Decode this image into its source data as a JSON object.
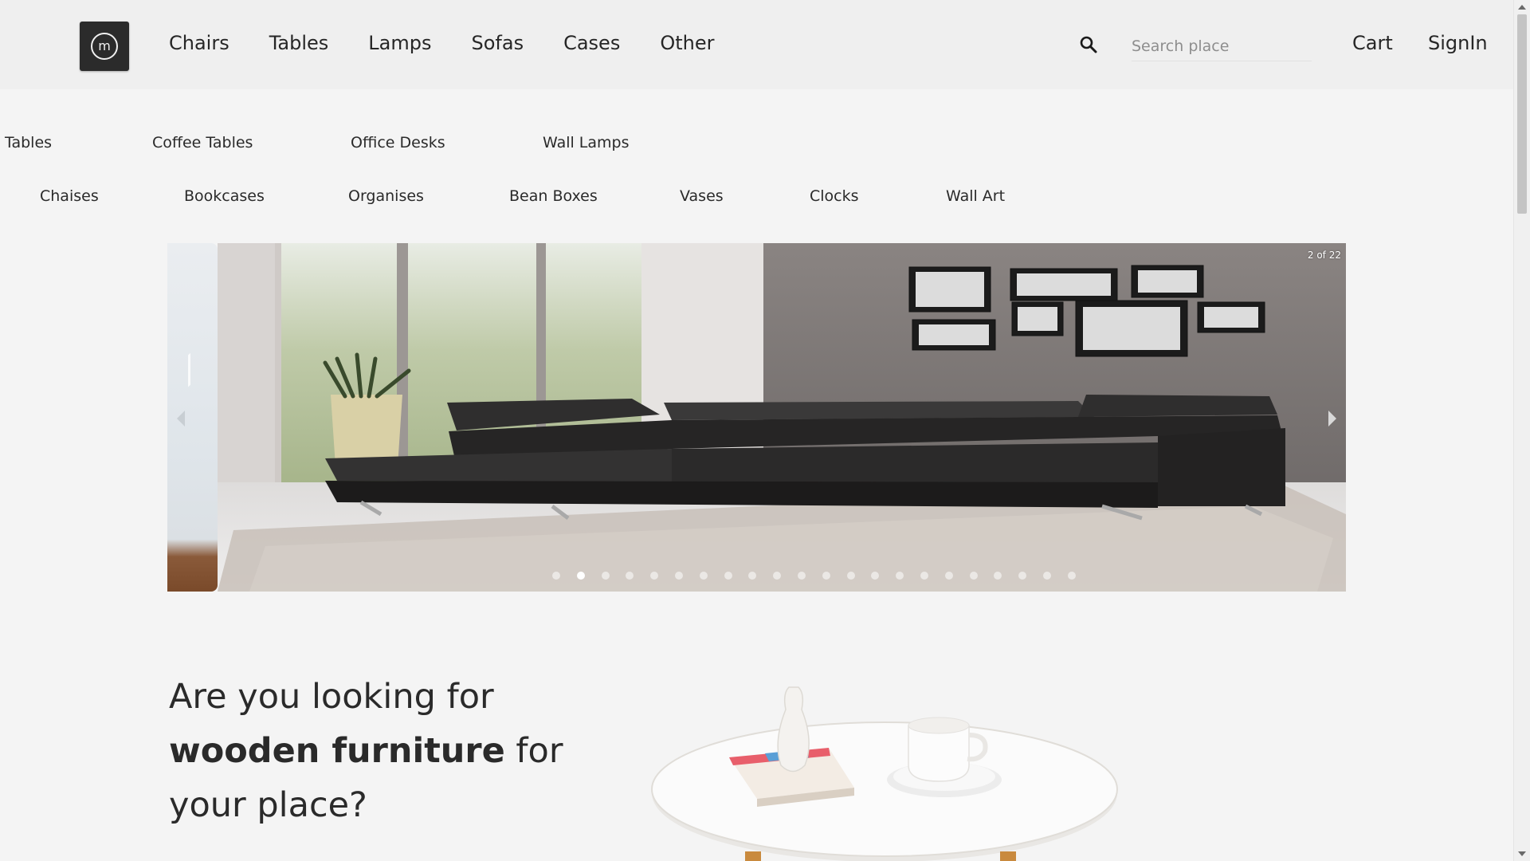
{
  "header": {
    "logo_letter": "m",
    "nav": [
      {
        "label": "Chairs"
      },
      {
        "label": "Tables"
      },
      {
        "label": "Lamps"
      },
      {
        "label": "Sofas"
      },
      {
        "label": "Cases"
      },
      {
        "label": "Other"
      }
    ],
    "search_placeholder": "Search place",
    "search_value": "",
    "cart_label": "Cart",
    "signin_label": "SignIn"
  },
  "subcategories": {
    "row1": [
      "Tables",
      "Coffee Tables",
      "Office Desks",
      "Wall Lamps"
    ],
    "row2": [
      "Chaises",
      "Bookcases",
      "Organises",
      "Bean Boxes",
      "Vases",
      "Clocks",
      "Wall Art"
    ]
  },
  "carousel": {
    "counter": "2 of 22",
    "current_index": 2,
    "total": 22
  },
  "hero": {
    "line1": "Are you looking for",
    "bold": "wooden furniture",
    "line2_rest": " for",
    "line3": "your place?"
  },
  "colors": {
    "background": "#f4f4f4",
    "header_bg": "#efefef",
    "logo_bg": "#2b2b2b",
    "text": "#262626"
  }
}
